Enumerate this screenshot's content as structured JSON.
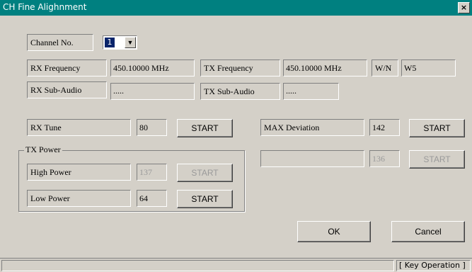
{
  "window": {
    "title": "CH Fine Alighnment",
    "close_symbol": "×"
  },
  "channel": {
    "label": "Channel No.",
    "value": "1"
  },
  "rx_frequency": {
    "label": "RX Frequency",
    "value": "450.10000 MHz"
  },
  "tx_frequency": {
    "label": "TX Frequency",
    "value": "450.10000 MHz"
  },
  "wn": {
    "label": "W/N",
    "value": "W5"
  },
  "rx_sub_audio": {
    "label": "RX Sub-Audio",
    "value": "....."
  },
  "tx_sub_audio": {
    "label": "TX Sub-Audio",
    "value": "....."
  },
  "rx_tune": {
    "label": "RX Tune",
    "value": "80",
    "button": "START"
  },
  "max_deviation": {
    "label": "MAX Deviation",
    "value": "142",
    "button": "START"
  },
  "unnamed_row": {
    "label": "",
    "value": "136",
    "button": "START"
  },
  "tx_power": {
    "title": "TX Power",
    "high": {
      "label": "High Power",
      "value": "137",
      "button": "START"
    },
    "low": {
      "label": "Low Power",
      "value": "64",
      "button": "START"
    }
  },
  "dialog": {
    "ok": "OK",
    "cancel": "Cancel"
  },
  "status": {
    "right": "[ Key Operation ]"
  }
}
